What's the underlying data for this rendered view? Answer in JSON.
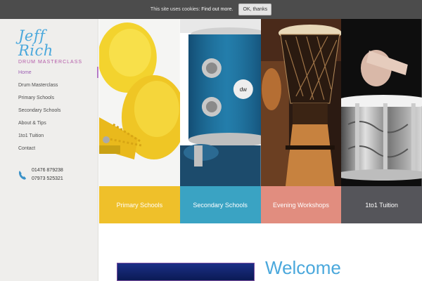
{
  "cookie": {
    "text": "This site uses cookies:",
    "link": "Find out more.",
    "button": "OK, thanks"
  },
  "logo": {
    "script": "Jeff Rich",
    "subtitle": "DRUM MASTERCLASS"
  },
  "nav": {
    "items": [
      {
        "label": "Home",
        "active": true
      },
      {
        "label": "Drum Masterclass"
      },
      {
        "label": "Primary Schools"
      },
      {
        "label": "Secondary Schools"
      },
      {
        "label": "About & Tips"
      },
      {
        "label": "1to1 Tuition"
      },
      {
        "label": "Contact"
      }
    ]
  },
  "contact": {
    "phone1": "01476 879238",
    "phone2": "07973 525321",
    "icon": "phone-icon"
  },
  "panels": [
    {
      "caption": "Primary Schools",
      "color": "#efc02a"
    },
    {
      "caption": "Secondary Schools",
      "color": "#3aa3c3"
    },
    {
      "caption": "Evening Workshops",
      "color": "#e18d7f"
    },
    {
      "caption": "1to1 Tuition",
      "color": "#55555a"
    }
  ],
  "welcome": {
    "heading": "Welcome"
  },
  "colors": {
    "accent": "#4aa8dc",
    "nav_active": "#9b5fb2",
    "cookie_bar": "#4c4c4c"
  }
}
